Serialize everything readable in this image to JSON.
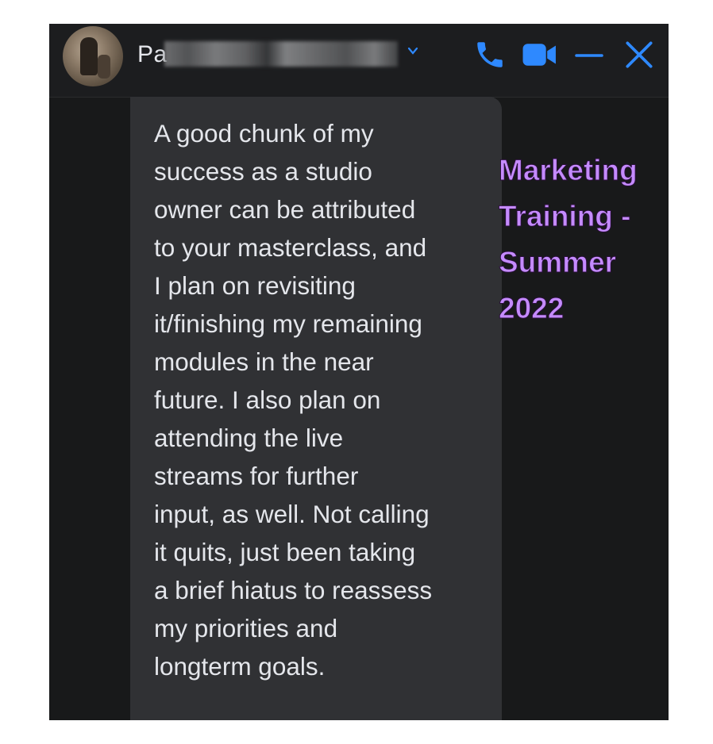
{
  "header": {
    "contact_name_visible": "Pa",
    "avatar_icon": "profile-photo",
    "chevron_icon": "chevron-down-icon",
    "actions": [
      {
        "name": "phone-icon",
        "color": "#2e89ff"
      },
      {
        "name": "video-icon",
        "color": "#2e89ff"
      },
      {
        "name": "minimize-icon",
        "color": "#2e89ff"
      },
      {
        "name": "close-icon",
        "color": "#2e89ff"
      }
    ]
  },
  "message": {
    "text": "A good chunk of my\nsuccess as a studio\nowner can be attributed\nto your masterclass, and\nI plan on revisiting\nit/finishing my remaining\nmodules in the near\nfuture. I also plan on\nattending the live\nstreams for further\ninput, as well. Not calling\nit quits, just been taking\na brief hiatus to reassess\nmy priorities and\nlongterm goals."
  },
  "overlay": {
    "caption": "Marketing\nTraining -\nSummer\n2022",
    "color": "#c58bff"
  },
  "colors": {
    "window_bg": "#18191a",
    "bubble_bg": "#303134",
    "accent": "#2e89ff",
    "text": "#e4e6eb"
  }
}
